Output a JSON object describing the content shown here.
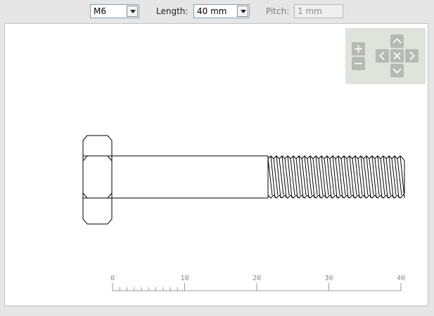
{
  "toolbar": {
    "size_value": "M6",
    "length_label": "Length:",
    "length_value": "40 mm",
    "pitch_label": "Pitch:",
    "pitch_value": "1 mm"
  },
  "navigator": {
    "zoom_in_icon": "plus-icon",
    "zoom_out_icon": "minus-icon",
    "pan_up_icon": "chevron-up-icon",
    "pan_down_icon": "chevron-down-icon",
    "pan_left_icon": "chevron-left-icon",
    "pan_right_icon": "chevron-right-icon",
    "reset_icon": "close-icon"
  },
  "ruler": {
    "ticks": [
      "0",
      "10",
      "20",
      "30",
      "40"
    ]
  },
  "colors": {
    "canvas_bg": "#ffffff",
    "navigator_bg": "#dfe3dc",
    "nav_button": "#b7bab4"
  }
}
